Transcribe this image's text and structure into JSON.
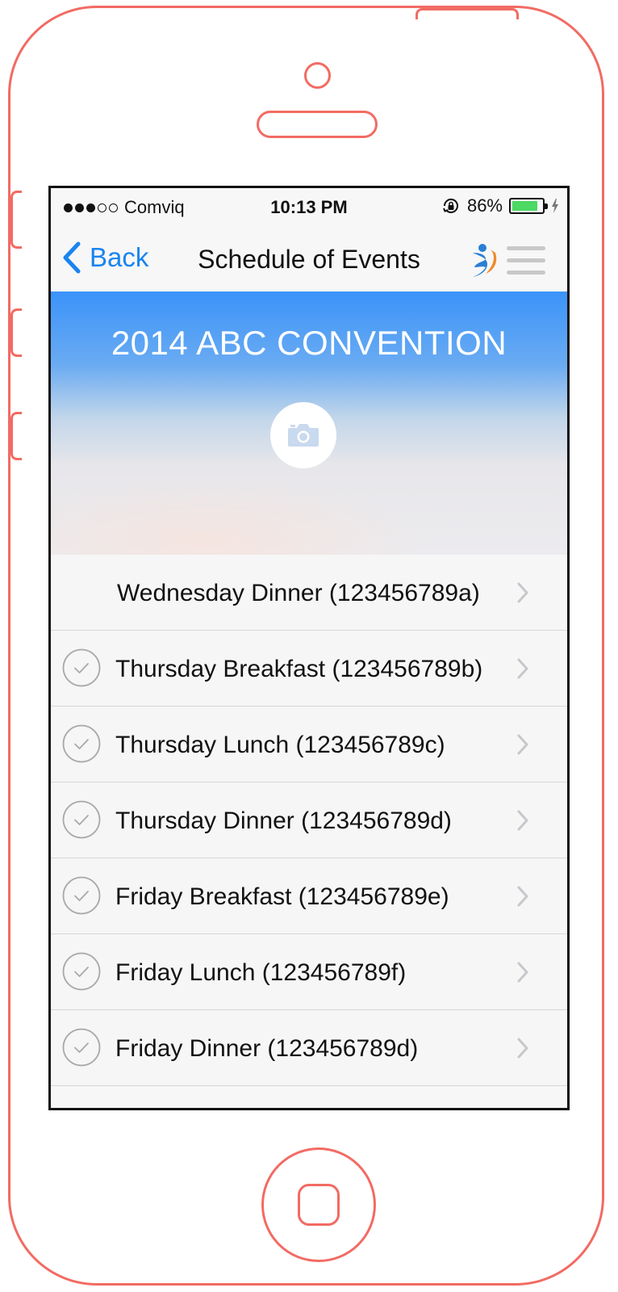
{
  "status_bar": {
    "signal_dots_filled": 3,
    "signal_dots_total": 5,
    "carrier": "Comviq",
    "time": "10:13 PM",
    "battery_percent": "86%",
    "battery_level": 0.86
  },
  "nav": {
    "back_label": "Back",
    "title": "Schedule of Events"
  },
  "hero": {
    "title": "2014 ABC CONVENTION"
  },
  "events": [
    {
      "label": "Wednesday Dinner (123456789a)",
      "checkable": false
    },
    {
      "label": "Thursday Breakfast (123456789b)",
      "checkable": true
    },
    {
      "label": "Thursday Lunch (123456789c)",
      "checkable": true
    },
    {
      "label": "Thursday Dinner (123456789d)",
      "checkable": true
    },
    {
      "label": "Friday Breakfast (123456789e)",
      "checkable": true
    },
    {
      "label": "Friday Lunch (123456789f)",
      "checkable": true
    },
    {
      "label": "Friday Dinner (123456789d)",
      "checkable": true
    }
  ],
  "colors": {
    "accent": "#1a84f0",
    "frame": "#f26b63",
    "battery": "#4cd964"
  }
}
